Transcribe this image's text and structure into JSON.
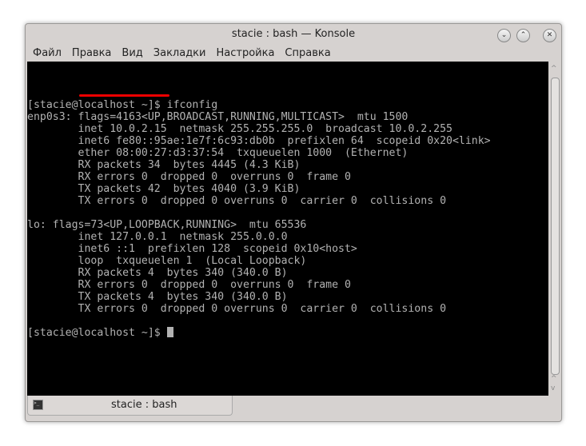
{
  "window": {
    "title": "stacie : bash — Konsole",
    "buttons": [
      "minimize",
      "maximize",
      "close"
    ]
  },
  "menu": [
    "Файл",
    "Правка",
    "Вид",
    "Закладки",
    "Настройка",
    "Справка"
  ],
  "terminal": {
    "lines": [
      "[stacie@localhost ~]$ ifconfig",
      "enp0s3: flags=4163<UP,BROADCAST,RUNNING,MULTICAST>  mtu 1500",
      "        inet 10.0.2.15  netmask 255.255.255.0  broadcast 10.0.2.255",
      "        inet6 fe80::95ae:1e7f:6c93:db0b  prefixlen 64  scopeid 0x20<link>",
      "        ether 08:00:27:d3:37:54  txqueuelen 1000  (Ethernet)",
      "        RX packets 34  bytes 4445 (4.3 KiB)",
      "        RX errors 0  dropped 0  overruns 0  frame 0",
      "        TX packets 42  bytes 4040 (3.9 KiB)",
      "        TX errors 0  dropped 0 overruns 0  carrier 0  collisions 0",
      "",
      "lo: flags=73<UP,LOOPBACK,RUNNING>  mtu 65536",
      "        inet 127.0.0.1  netmask 255.0.0.0",
      "        inet6 ::1  prefixlen 128  scopeid 0x10<host>",
      "        loop  txqueuelen 1  (Local Loopback)",
      "        RX packets 4  bytes 340 (340.0 B)",
      "        RX errors 0  dropped 0  overruns 0  frame 0",
      "        TX packets 4  bytes 340 (340.0 B)",
      "        TX errors 0  dropped 0 overruns 0  carrier 0  collisions 0",
      "",
      "[stacie@localhost ~]$ "
    ],
    "highlight_color": "#ee0000"
  },
  "tab": {
    "label": "stacie : bash"
  }
}
